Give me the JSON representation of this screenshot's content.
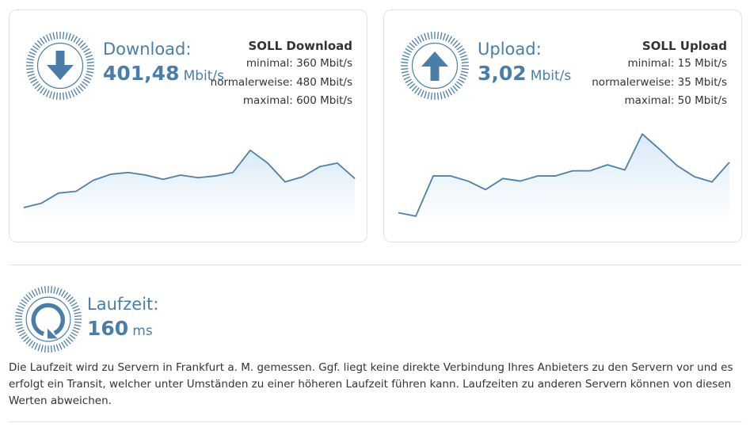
{
  "download": {
    "label": "Download:",
    "value": "401,48",
    "unit": "Mbit/s",
    "icon": "arrow-down-icon",
    "soll": {
      "title": "SOLL Download",
      "minimal": "minimal: 360 Mbit/s",
      "normal": "normalerweise: 480 Mbit/s",
      "maximal": "maximal: 600 Mbit/s"
    }
  },
  "upload": {
    "label": "Upload:",
    "value": "3,02",
    "unit": "Mbit/s",
    "icon": "arrow-up-icon",
    "soll": {
      "title": "SOLL Upload",
      "minimal": "minimal: 15 Mbit/s",
      "normal": "normalerweise: 35 Mbit/s",
      "maximal": "maximal: 50 Mbit/s"
    }
  },
  "latency": {
    "label": "Laufzeit:",
    "value": "160",
    "unit": "ms",
    "icon": "refresh-circle-icon",
    "note": "Die Laufzeit wird zu Servern in Frankfurt a. M. gemessen. Ggf. liegt keine direkte Verbindung Ihres Anbieters zu den Servern vor und es erfolgt ein Transit, welcher unter Umständen zu einer höheren Laufzeit führen kann. Laufzeiten zu anderen Servern können von diesen Werten abweichen."
  },
  "colors": {
    "accent": "#4a7ea8",
    "line": "#4f7fa6",
    "fill": "#d9eaf8",
    "border": "#e2e2e2"
  },
  "chart_data": [
    {
      "type": "area",
      "series": [
        {
          "values": [
            0.12,
            0.17,
            0.29,
            0.31,
            0.44,
            0.51,
            0.53,
            0.5,
            0.45,
            0.5,
            0.47,
            0.49,
            0.53,
            0.79,
            0.64,
            0.42,
            0.48,
            0.6,
            0.64,
            0.46
          ]
        }
      ],
      "ylim": [
        0,
        1
      ],
      "grid": false
    },
    {
      "type": "area",
      "series": [
        {
          "values": [
            0.06,
            0.02,
            0.49,
            0.49,
            0.43,
            0.33,
            0.46,
            0.43,
            0.49,
            0.49,
            0.55,
            0.55,
            0.62,
            0.56,
            0.98,
            0.8,
            0.61,
            0.48,
            0.42,
            0.65
          ]
        }
      ],
      "ylim": [
        0,
        1
      ],
      "grid": false
    }
  ]
}
